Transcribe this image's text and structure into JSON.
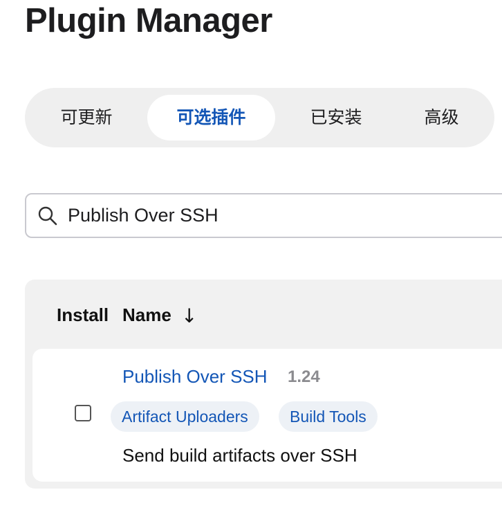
{
  "page": {
    "title": "Plugin Manager"
  },
  "tabs": [
    {
      "label": "可更新",
      "selected": false
    },
    {
      "label": "可选插件",
      "selected": true
    },
    {
      "label": "已安装",
      "selected": false
    },
    {
      "label": "高级",
      "selected": false
    }
  ],
  "search": {
    "icon": "search-icon",
    "value": "Publish Over SSH"
  },
  "table": {
    "headers": {
      "install": "Install",
      "name": "Name",
      "sort_icon": "↓"
    },
    "rows": [
      {
        "name": "Publish Over SSH",
        "version": "1.24",
        "tags": [
          "Artifact Uploaders",
          "Build Tools"
        ],
        "description": "Send build artifacts over SSH",
        "checked": false
      }
    ]
  },
  "colors": {
    "accent": "#1356b6",
    "tab_bar_bg": "#efefef",
    "panel_bg": "#f1f1f1",
    "tag_bg": "#edf1f6",
    "version_gray": "#8b8b8f"
  }
}
